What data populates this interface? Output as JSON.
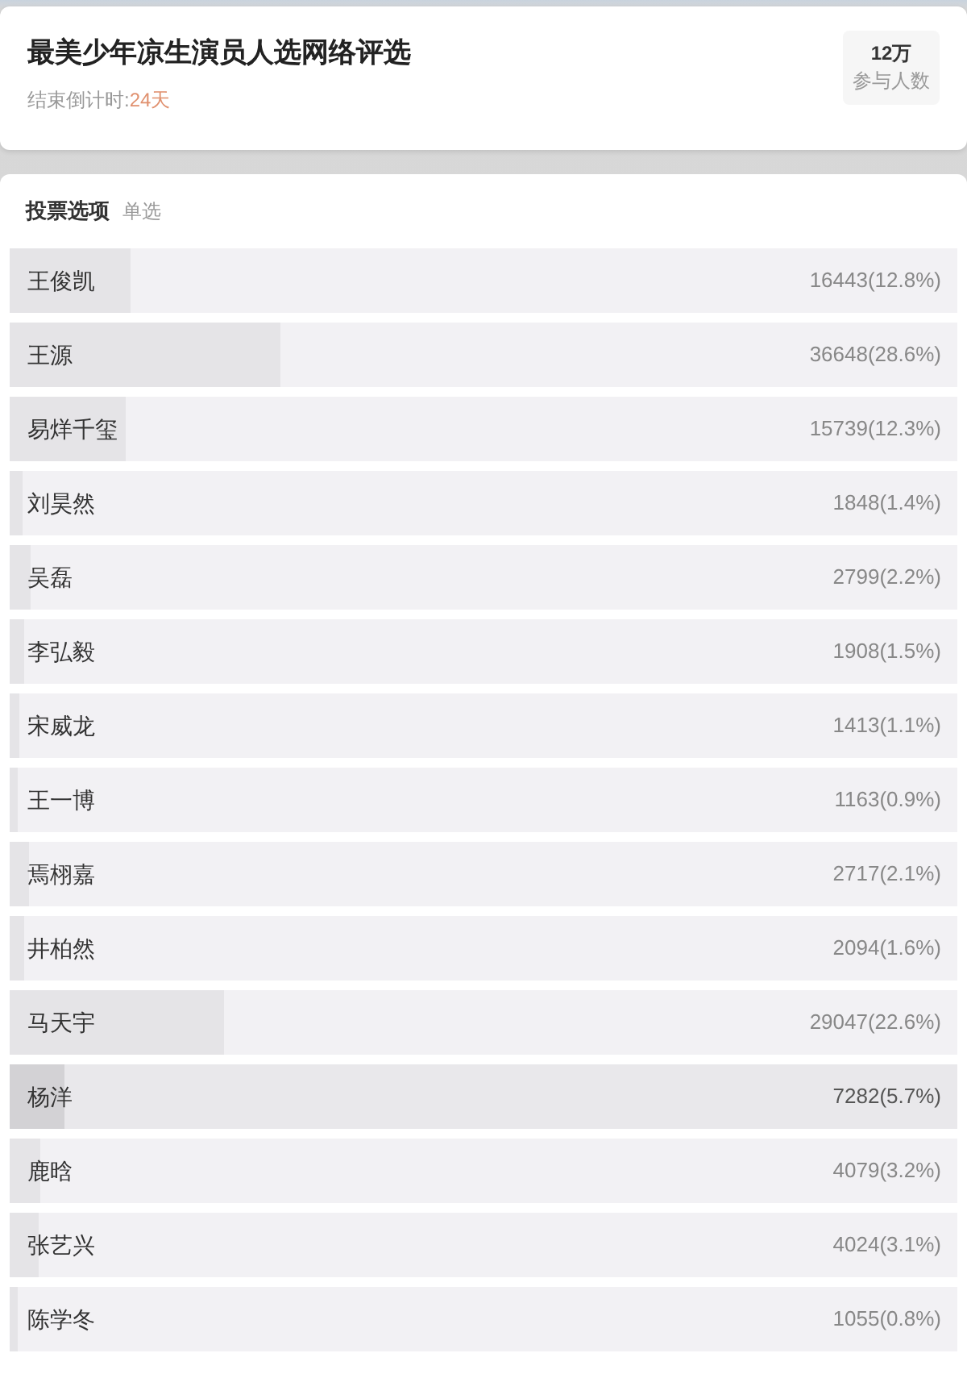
{
  "header": {
    "title": "最美少年凉生演员人选网络评选",
    "countdown_label": "结束倒计时:",
    "countdown_value": "24天",
    "participants": {
      "value": "12万",
      "label": "参与人数"
    }
  },
  "options_section": {
    "title": "投票选项",
    "mode": "单选"
  },
  "options": [
    {
      "name": "王俊凯",
      "count": "16443(12.8%)",
      "level": 0.128,
      "selected": false
    },
    {
      "name": "王源",
      "count": "36648(28.6%)",
      "level": 0.286,
      "selected": false
    },
    {
      "name": "易烊千玺",
      "count": "15739(12.3%)",
      "level": 0.123,
      "selected": false
    },
    {
      "name": "刘昊然",
      "count": "1848(1.4%)",
      "level": 0.014,
      "selected": false
    },
    {
      "name": "吴磊",
      "count": "2799(2.2%)",
      "level": 0.022,
      "selected": false
    },
    {
      "name": "李弘毅",
      "count": "1908(1.5%)",
      "level": 0.015,
      "selected": false
    },
    {
      "name": "宋威龙",
      "count": "1413(1.1%)",
      "level": 0.011,
      "selected": false
    },
    {
      "name": "王一博",
      "count": "1163(0.9%)",
      "level": 0.009,
      "selected": false
    },
    {
      "name": "焉栩嘉",
      "count": "2717(2.1%)",
      "level": 0.021,
      "selected": false
    },
    {
      "name": "井柏然",
      "count": "2094(1.6%)",
      "level": 0.016,
      "selected": false
    },
    {
      "name": "马天宇",
      "count": "29047(22.6%)",
      "level": 0.226,
      "selected": false
    },
    {
      "name": "杨洋",
      "count": "7282(5.7%)",
      "level": 0.057,
      "selected": true
    },
    {
      "name": "鹿晗",
      "count": "4079(3.2%)",
      "level": 0.032,
      "selected": false
    },
    {
      "name": "张艺兴",
      "count": "4024(3.1%)",
      "level": 0.031,
      "selected": false
    },
    {
      "name": "陈学冬",
      "count": "1055(0.8%)",
      "level": 0.008,
      "selected": false
    }
  ]
}
